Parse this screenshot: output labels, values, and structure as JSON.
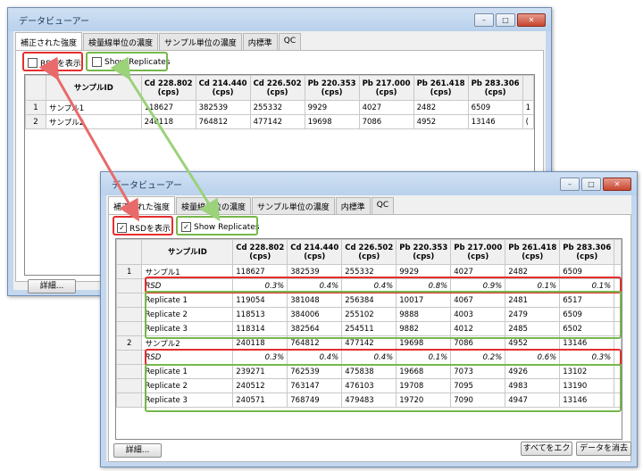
{
  "window_title": "データビューアー",
  "window_controls": [
    "–",
    "□",
    "✕"
  ],
  "tabs": [
    "補正された強度",
    "検量線単位の濃度",
    "サンプル単位の濃度",
    "内標準",
    "QC"
  ],
  "options": {
    "rsd_label": "RSDを表示",
    "replicates_label": "Show Replicates"
  },
  "columns": [
    "サンプルID",
    "Cd 228.802\n(cps)",
    "Cd 214.440\n(cps)",
    "Cd 226.502\n(cps)",
    "Pb 220.353\n(cps)",
    "Pb 217.000\n(cps)",
    "Pb 261.418\n(cps)",
    "Pb 283.306\n(cps)"
  ],
  "before": {
    "rows": [
      {
        "idx": "1",
        "id": "サンプル1",
        "vals": [
          "118627",
          "382539",
          "255332",
          "9929",
          "4027",
          "2482",
          "6509"
        ],
        "trail": "1"
      },
      {
        "idx": "2",
        "id": "サンプル2",
        "vals": [
          "240118",
          "764812",
          "477142",
          "19698",
          "7086",
          "4952",
          "13146"
        ],
        "trail": "("
      }
    ]
  },
  "after": {
    "rows": [
      {
        "kind": "sample",
        "idx": "1",
        "id": "サンプル1",
        "vals": [
          "118627",
          "382539",
          "255332",
          "9929",
          "4027",
          "2482",
          "6509"
        ]
      },
      {
        "kind": "rsd",
        "idx": "",
        "id": "RSD",
        "vals": [
          "0.3%",
          "0.4%",
          "0.4%",
          "0.8%",
          "0.9%",
          "0.1%",
          "0.1%"
        ]
      },
      {
        "kind": "rep",
        "idx": "",
        "id": "Replicate 1",
        "vals": [
          "119054",
          "381048",
          "256384",
          "10017",
          "4067",
          "2481",
          "6517"
        ]
      },
      {
        "kind": "rep",
        "idx": "",
        "id": "Replicate 2",
        "vals": [
          "118513",
          "384006",
          "255102",
          "9888",
          "4003",
          "2479",
          "6509"
        ]
      },
      {
        "kind": "rep",
        "idx": "",
        "id": "Replicate 3",
        "vals": [
          "118314",
          "382564",
          "254511",
          "9882",
          "4012",
          "2485",
          "6502"
        ]
      },
      {
        "kind": "sample",
        "idx": "2",
        "id": "サンプル2",
        "vals": [
          "240118",
          "764812",
          "477142",
          "19698",
          "7086",
          "4952",
          "13146"
        ]
      },
      {
        "kind": "rsd",
        "idx": "",
        "id": "RSD",
        "vals": [
          "0.3%",
          "0.4%",
          "0.4%",
          "0.1%",
          "0.2%",
          "0.6%",
          "0.3%"
        ]
      },
      {
        "kind": "rep",
        "idx": "",
        "id": "Replicate 1",
        "vals": [
          "239271",
          "762539",
          "475838",
          "19668",
          "7073",
          "4926",
          "13102"
        ]
      },
      {
        "kind": "rep",
        "idx": "",
        "id": "Replicate 2",
        "vals": [
          "240512",
          "763147",
          "476103",
          "19708",
          "7095",
          "4983",
          "13190"
        ]
      },
      {
        "kind": "rep",
        "idx": "",
        "id": "Replicate 3",
        "vals": [
          "240571",
          "768749",
          "479483",
          "19720",
          "7090",
          "4947",
          "13146"
        ]
      }
    ]
  },
  "buttons": {
    "details": "詳細...",
    "view_all": "すべてをエク",
    "clear_data": "データを消去"
  },
  "colors": {
    "highlight_red": "#e62e2e",
    "highlight_green": "#76b84b"
  }
}
